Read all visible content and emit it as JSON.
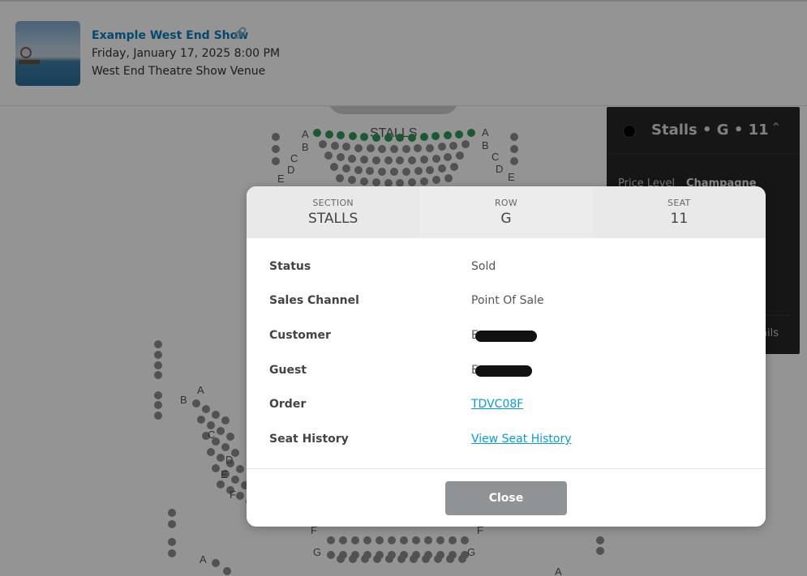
{
  "event": {
    "title": "Example West End Show",
    "datetime": "Friday, January 17, 2025 8:00 PM",
    "venue": "West End Theatre Show Venue",
    "link_icon": "external-link-icon"
  },
  "seatmap": {
    "stalls_label": "STALLS",
    "row_labels": [
      "A",
      "B",
      "C",
      "D",
      "E",
      "F",
      "G"
    ],
    "colors": {
      "seat_available": "#8d8d8d",
      "seat_selected_row": "#2e9a55"
    }
  },
  "side_panel": {
    "title": "Stalls • G • 11",
    "price_level_label": "Price Level",
    "price_level_value": "Champagne",
    "details_link": "ails"
  },
  "modal": {
    "section": {
      "label": "SECTION",
      "value": "STALLS"
    },
    "row": {
      "label": "ROW",
      "value": "G"
    },
    "seat": {
      "label": "SEAT",
      "value": "11"
    },
    "rows": [
      {
        "label": "Status",
        "value": "Sold"
      },
      {
        "label": "Sales Channel",
        "value": "Point Of Sale"
      },
      {
        "label": "Customer",
        "value": "E",
        "redacted": true
      },
      {
        "label": "Guest",
        "value": "E",
        "redacted": true
      },
      {
        "label": "Order",
        "value": "TDVC08F",
        "link": true
      },
      {
        "label": "Seat History",
        "value": "View Seat History",
        "link": true
      }
    ],
    "close_label": "Close"
  }
}
